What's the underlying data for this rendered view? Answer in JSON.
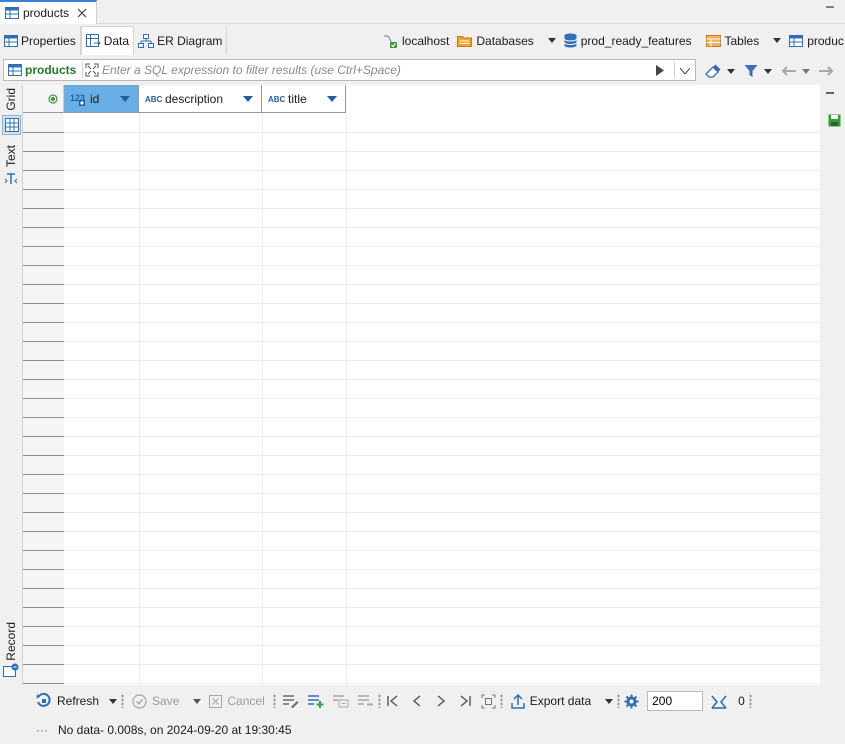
{
  "editor_tab": {
    "label": "products"
  },
  "subtabs": [
    {
      "label": "Properties"
    },
    {
      "label": "Data"
    },
    {
      "label": "ER Diagram"
    }
  ],
  "breadcrumbs": [
    {
      "label": "localhost"
    },
    {
      "label": "Databases"
    },
    {
      "label": "prod_ready_features"
    },
    {
      "label": "Tables"
    },
    {
      "label": "produc"
    }
  ],
  "filter": {
    "table_label": "products",
    "placeholder": "Enter a SQL expression to filter results (use Ctrl+Space)"
  },
  "side_panel": {
    "grid_label": "Grid",
    "text_label": "Text",
    "record_label": "Record"
  },
  "columns": [
    {
      "type_badge": "123",
      "name": "id"
    },
    {
      "type_badge": "ABC",
      "name": "description"
    },
    {
      "type_badge": "ABC",
      "name": "title"
    }
  ],
  "toolbar": {
    "refresh_label": "Refresh",
    "save_label": "Save",
    "cancel_label": "Cancel",
    "export_label": "Export data",
    "fetch_size": "200",
    "row_count": "0"
  },
  "status": {
    "ellipsis": "···",
    "text": "No data- 0.008s, on 2024-09-20 at 19:30:45"
  },
  "colors": {
    "accent": "#3c7fd6",
    "selected_header": "#6aaee6",
    "green": "#217a2a",
    "orange": "#e08a1e"
  }
}
